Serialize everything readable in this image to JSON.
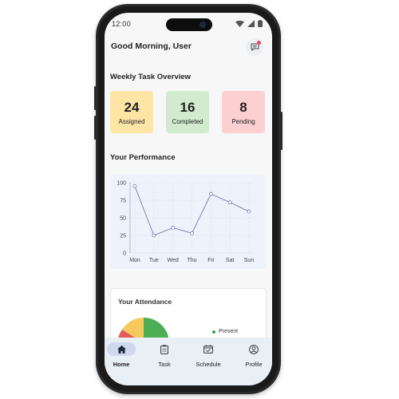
{
  "status_bar": {
    "time": "12:00"
  },
  "header": {
    "greeting": "Good Morning, User",
    "message_icon": "message-icon"
  },
  "weekly": {
    "title": "Weekly Task Overview",
    "cards": [
      {
        "value": "24",
        "label": "Assigned",
        "color": "#fde5a6"
      },
      {
        "value": "16",
        "label": "Completed",
        "color": "#d2ebcf"
      },
      {
        "value": "8",
        "label": "Pending",
        "color": "#fccfd1"
      }
    ]
  },
  "performance": {
    "title": "Your Performance"
  },
  "chart_data": {
    "type": "line",
    "categories": [
      "Mon",
      "Tue",
      "Wed",
      "Thu",
      "Fri",
      "Sat",
      "Sun"
    ],
    "values": [
      95,
      25,
      36,
      28,
      84,
      72,
      59
    ],
    "ylim": [
      0,
      100
    ],
    "yticks": [
      0,
      25,
      50,
      75,
      100
    ],
    "grid": true,
    "line_color": "#6a7cb0",
    "background": "#eef2fb"
  },
  "attendance": {
    "title": "Your Attendance",
    "legend": [
      {
        "label": "Present",
        "color": "#3a9b4a"
      }
    ],
    "pie_colors": {
      "present": "#4cae55",
      "other": "#f6c95d",
      "absent": "#e45a5a"
    }
  },
  "nav": {
    "items": [
      {
        "label": "Home",
        "icon": "home-icon",
        "active": true
      },
      {
        "label": "Task",
        "icon": "clipboard-icon",
        "active": false
      },
      {
        "label": "Schedule",
        "icon": "calendar-icon",
        "active": false
      },
      {
        "label": "Profile",
        "icon": "profile-icon",
        "active": false
      }
    ]
  }
}
